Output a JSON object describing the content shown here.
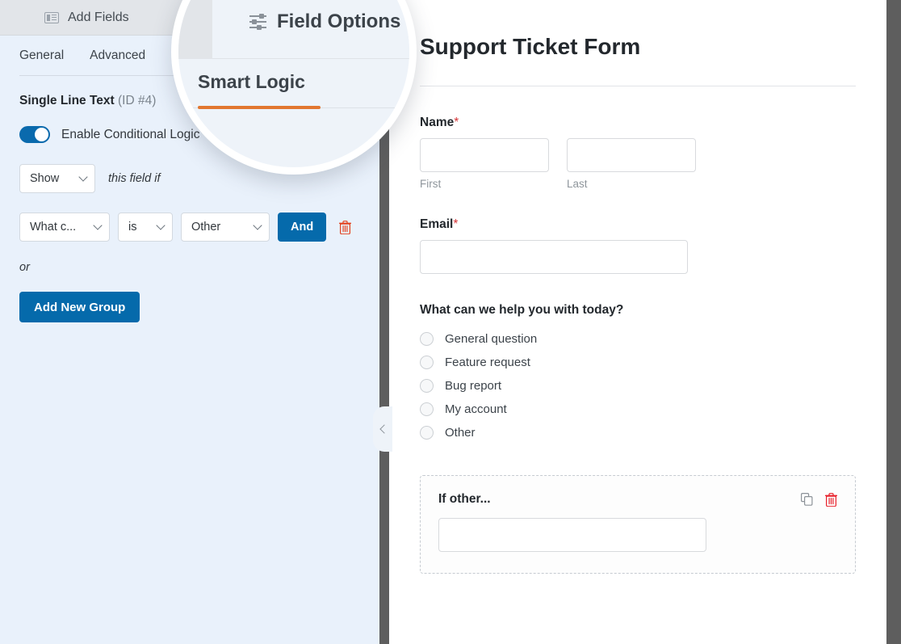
{
  "sidebar": {
    "topbar": {
      "add_fields_label": "Add Fields",
      "field_options_label": "Field Options"
    },
    "tabs": [
      {
        "label": "General",
        "active": false
      },
      {
        "label": "Advanced",
        "active": false
      },
      {
        "label": "Smart Logic",
        "active": true
      }
    ],
    "field": {
      "type_label": "Single Line Text",
      "id_label": "(ID #4)"
    },
    "conditional": {
      "toggle_label": "Enable Conditional Logic",
      "toggle_on": true,
      "help_glyph": "?",
      "action_select": "Show",
      "action_suffix": "this field if",
      "rule": {
        "field_select": "What c...",
        "operator_select": "is",
        "value_select": "Other",
        "and_button": "And",
        "delete_icon": "trash-icon"
      },
      "or_text": "or",
      "add_group_button": "Add New Group"
    }
  },
  "divider": {
    "collapse_icon": "chevron-left-icon"
  },
  "preview": {
    "form_title": "Support Ticket Form",
    "fields": [
      {
        "label": "Name",
        "required": true,
        "required_marker": "*",
        "type": "name",
        "sub": [
          {
            "value": "",
            "sublabel": "First"
          },
          {
            "value": "",
            "sublabel": "Last"
          }
        ]
      },
      {
        "label": "Email",
        "required": true,
        "required_marker": "*",
        "type": "text",
        "value": ""
      },
      {
        "label": "What can we help you with today?",
        "required": false,
        "type": "radio",
        "options": [
          "General question",
          "Feature request",
          "Bug report",
          "My account",
          "Other"
        ]
      }
    ],
    "highlighted_field": {
      "label": "If other...",
      "value": "",
      "duplicate_icon": "copy-icon",
      "delete_icon": "trash-icon"
    }
  },
  "colors": {
    "accent_blue": "#056aab",
    "accent_orange": "#e27730",
    "danger_red": "#d63638",
    "sidebar_bg": "#e9f1fb",
    "divider_gray": "#5e5e5e"
  }
}
